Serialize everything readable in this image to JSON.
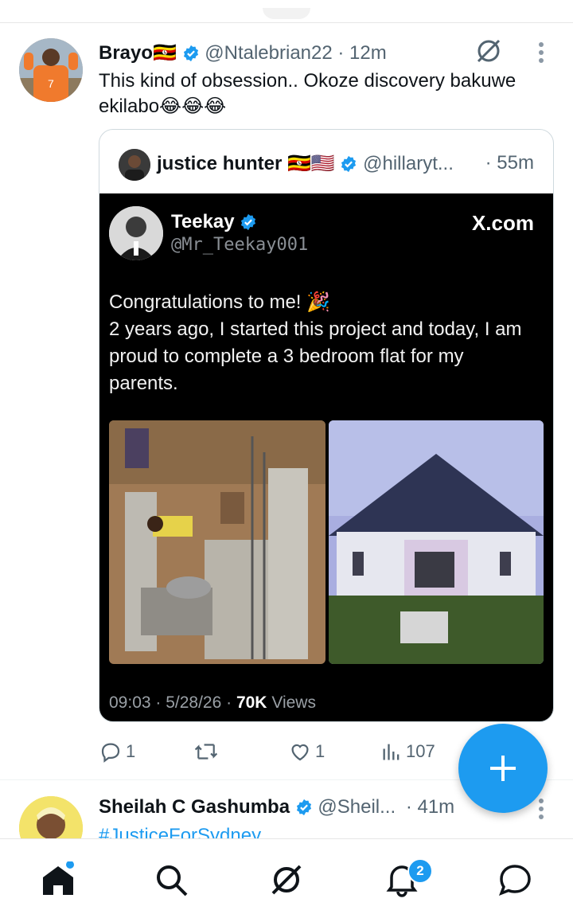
{
  "tweet1": {
    "name": "Brayo",
    "flag": "🇺🇬",
    "handle": "@Ntalebrian22",
    "time": "· 12m",
    "text_line1": "This kind of obsession.. Okoze discovery bakuwe",
    "text_line2": "ekilabo😂😂😂"
  },
  "quoted": {
    "name": "justice hunter",
    "flags": "🇺🇬🇺🇸",
    "handle": "@hillaryt...",
    "time": "· 55m"
  },
  "embedded": {
    "name": "Teekay",
    "handle": "@Mr_Teekay001",
    "brand": "X.com",
    "line1": "Congratulations to me! 🎉",
    "line2": "2 years ago, I started this project and today, I am",
    "line3": "proud to complete a 3 bedroom flat for my",
    "line4": "parents.",
    "meta_time": "09:03 · 5/28/26 · ",
    "meta_views_count": "70K",
    "meta_views_label": " Views"
  },
  "actions": {
    "reply_count": "1",
    "repost_count": "",
    "like_count": "1",
    "views_count": "107"
  },
  "tweet2": {
    "name": "Sheilah C Gashumba",
    "handle": "@Sheil...",
    "time": "· 41m",
    "text": "#JusticeForSydney"
  },
  "nav": {
    "notifications_badge": "2"
  },
  "colors": {
    "accent": "#1d9bf0",
    "text": "#0f1419",
    "muted": "#536471"
  }
}
